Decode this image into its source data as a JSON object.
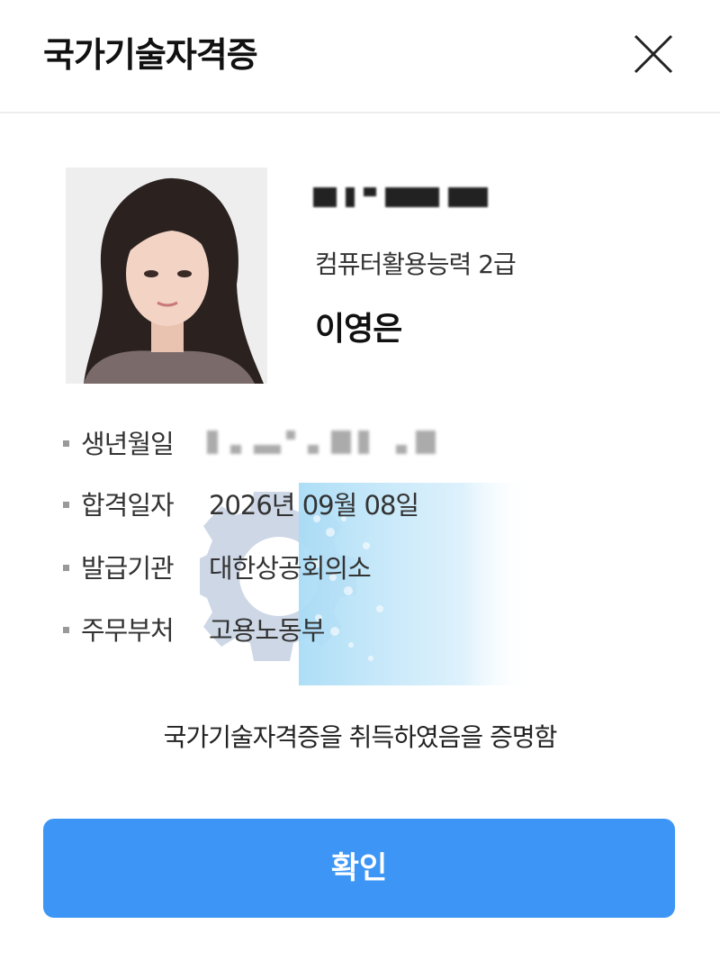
{
  "header": {
    "title": "국가기술자격증",
    "close_icon": "close-icon"
  },
  "certificate": {
    "number_redacted": true,
    "name": "컴퓨터활용능력 2급",
    "holder": "이영은"
  },
  "details": [
    {
      "label": "생년월일",
      "value": "",
      "redacted": true
    },
    {
      "label": "합격일자",
      "value": "2026년 09월 08일"
    },
    {
      "label": "발급기관",
      "value": "대한상공회의소"
    },
    {
      "label": "주무부처",
      "value": "고용노동부"
    }
  ],
  "statement": "국가기술자격증을 취득하였음을 증명함",
  "confirm_label": "확인",
  "colors": {
    "accent": "#3d95f5",
    "watermark_gear": "#c8d3e3",
    "watermark_blue": "#a9dcf6"
  }
}
